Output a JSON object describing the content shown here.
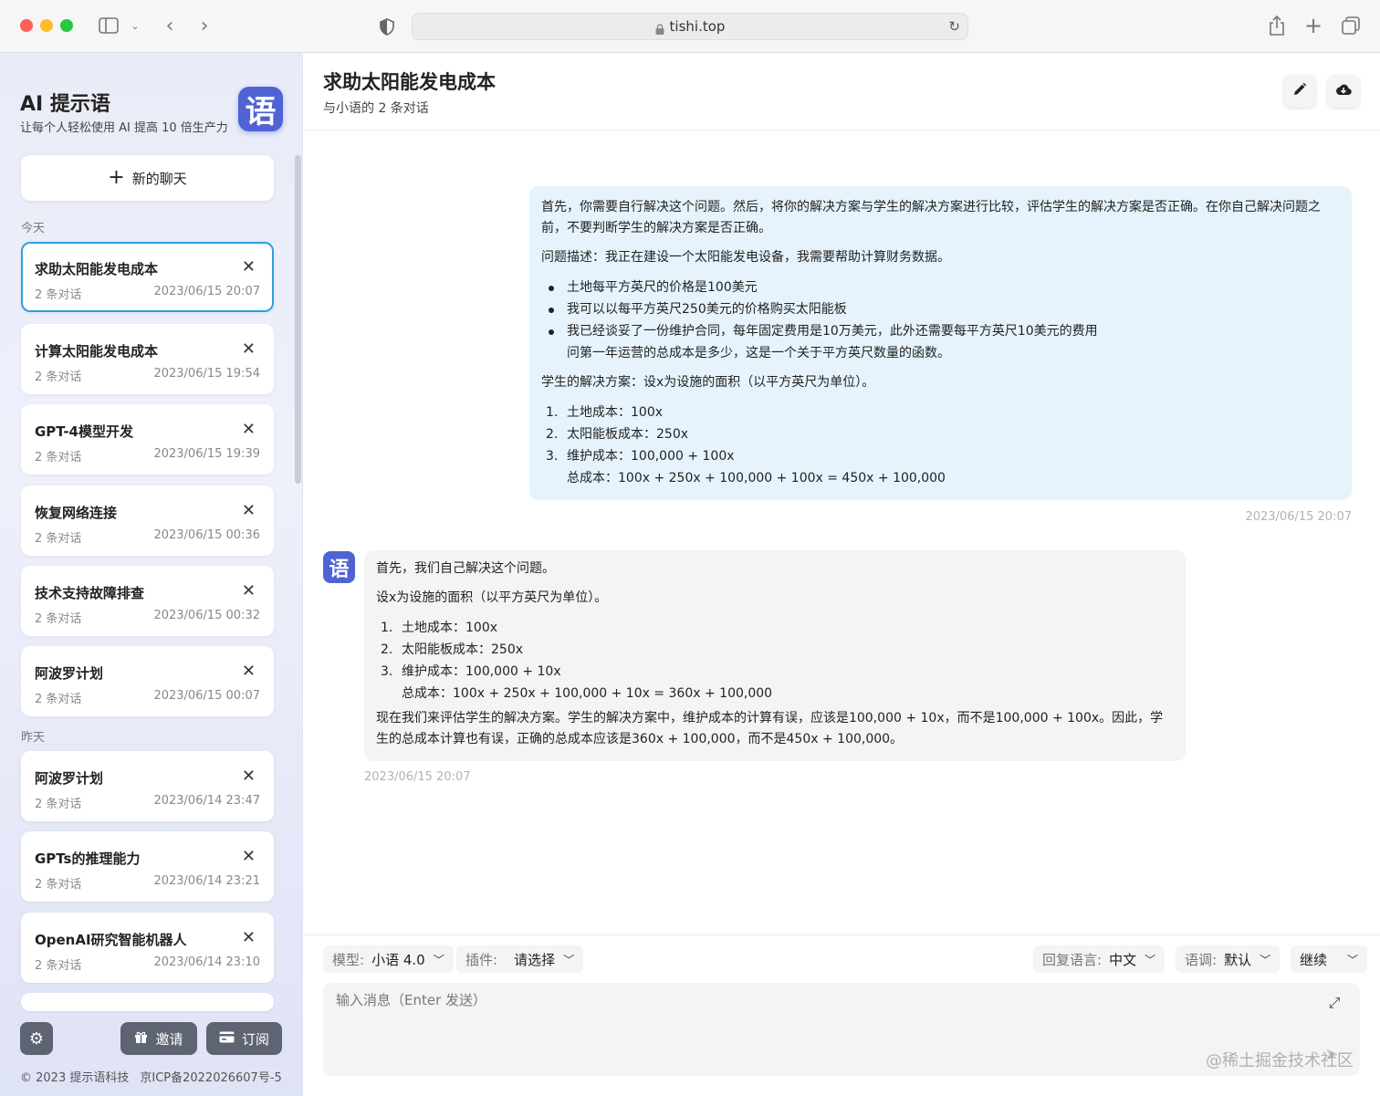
{
  "browser": {
    "url": "tishi.top"
  },
  "sidebar": {
    "brand_title": "AI 提示语",
    "brand_subtitle": "让每个人轻松使用 AI 提高 10 倍生产力",
    "logo_glyph": "语",
    "new_chat_label": "新的聊天",
    "section_today": "今天",
    "section_yesterday": "昨天",
    "chats": [
      {
        "title": "求助太阳能发电成本",
        "count": "2 条对话",
        "time": "2023/06/15 20:07",
        "active": true
      },
      {
        "title": "计算太阳能发电成本",
        "count": "2 条对话",
        "time": "2023/06/15 19:54"
      },
      {
        "title": "GPT-4模型开发",
        "count": "2 条对话",
        "time": "2023/06/15 19:39"
      },
      {
        "title": "恢复网络连接",
        "count": "2 条对话",
        "time": "2023/06/15 00:36"
      },
      {
        "title": "技术支持故障排查",
        "count": "2 条对话",
        "time": "2023/06/15 00:32"
      },
      {
        "title": "阿波罗计划",
        "count": "2 条对话",
        "time": "2023/06/15 00:07"
      },
      {
        "title": "阿波罗计划",
        "count": "2 条对话",
        "time": "2023/06/14 23:47"
      },
      {
        "title": "GPTs的推理能力",
        "count": "2 条对话",
        "time": "2023/06/14 23:21"
      },
      {
        "title": "OpenAI研究智能机器人",
        "count": "2 条对话",
        "time": "2023/06/14 23:10"
      }
    ],
    "invite_label": "邀请",
    "subscribe_label": "订阅",
    "footer_copyright": "© 2023 提示语科技",
    "footer_icp": "京ICP备2022026607号-5"
  },
  "main": {
    "title": "求助太阳能发电成本",
    "subtitle": "与小语的 2 条对话",
    "user_message": {
      "p1": "首先，你需要自行解决这个问题。然后，将你的解决方案与学生的解决方案进行比较，评估学生的解决方案是否正确。在你自己解决问题之前，不要判断学生的解决方案是否正确。",
      "p2": "问题描述：我正在建设一个太阳能发电设备，我需要帮助计算财务数据。",
      "bullets": [
        "土地每平方英尺的价格是100美元",
        "我可以以每平方英尺250美元的价格购买太阳能板",
        "我已经谈妥了一份维护合同，每年固定费用是10万美元，此外还需要每平方英尺10美元的费用"
      ],
      "bullet_tail": "问第一年运营的总成本是多少，这是一个关于平方英尺数量的函数。",
      "p3": "学生的解决方案：设x为设施的面积（以平方英尺为单位）。",
      "steps": [
        "土地成本：100x",
        "太阳能板成本：250x",
        "维护成本：100,000 + 100x"
      ],
      "total": "总成本：100x + 250x + 100,000 + 100x = 450x + 100,000",
      "time": "2023/06/15 20:07"
    },
    "bot_message": {
      "avatar_glyph": "语",
      "p1": "首先，我们自己解决这个问题。",
      "p2": "设x为设施的面积（以平方英尺为单位）。",
      "steps": [
        "土地成本：100x",
        "太阳能板成本：250x",
        "维护成本：100,000 + 10x"
      ],
      "total": "总成本：100x + 250x + 100,000 + 10x = 360x + 100,000",
      "p3": "现在我们来评估学生的解决方案。学生的解决方案中，维护成本的计算有误，应该是100,000 + 10x，而不是100,000 + 100x。因此，学生的总成本计算也有误，正确的总成本应该是360x + 100,000，而不是450x + 100,000。",
      "time": "2023/06/15 20:07"
    },
    "toolbar": {
      "model_label": "模型:",
      "model_value": "小语 4.0",
      "plugin_label": "插件:",
      "plugin_value": "请选择",
      "reply_lang_label": "回复语言:",
      "reply_lang_value": "中文",
      "tone_label": "语调:",
      "tone_value": "默认",
      "continue_label": "继续"
    },
    "input_placeholder": "输入消息（Enter 发送）",
    "watermark": "@稀土掘金技术社区"
  }
}
